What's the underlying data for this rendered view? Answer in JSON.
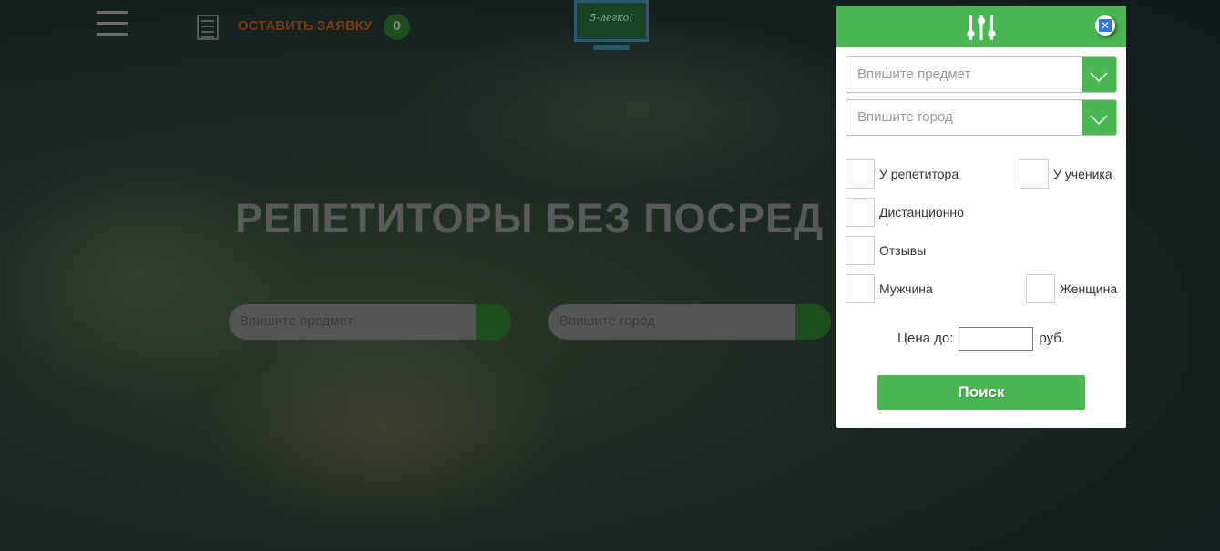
{
  "header": {
    "request_label": "ОСТАВИТЬ ЗАЯВКУ",
    "request_count": "0",
    "logo_text": "5-легко!"
  },
  "hero": {
    "title": "РЕПЕТИТОРЫ БЕЗ ПОСРЕД",
    "subject_placeholder": "Впишите предмет",
    "city_placeholder": "Впишите город"
  },
  "filter": {
    "subject_placeholder": "Впишите предмет",
    "city_placeholder": "Впишите город",
    "checkboxes": {
      "at_tutor": "У репетитора",
      "at_student": "У ученика",
      "remote": "Дистанционно",
      "reviews": "Отзывы",
      "male": "Мужчина",
      "female": "Женщина"
    },
    "price_label": "Цена до:",
    "price_value": "",
    "currency": "руб.",
    "search_label": "Поиск"
  },
  "colors": {
    "accent": "#4bb752",
    "close": "#2a7ae0"
  }
}
